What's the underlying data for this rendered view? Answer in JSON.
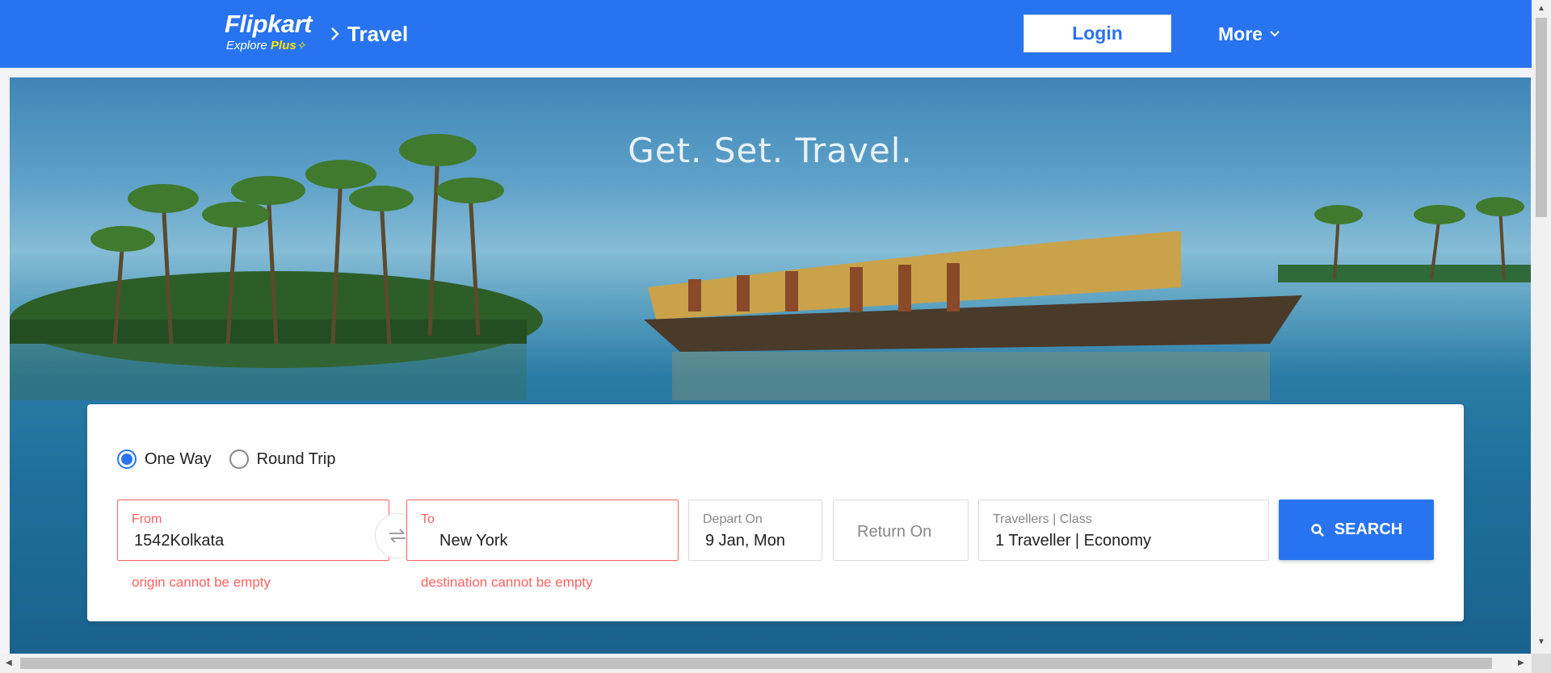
{
  "header": {
    "logo_main": "Flipkart",
    "logo_sub": "Explore",
    "logo_plus": "Plus",
    "breadcrumb": "Travel",
    "login_label": "Login",
    "more_label": "More",
    "bg_color": "#2874f0"
  },
  "hero": {
    "title": "Get. Set. Travel."
  },
  "search": {
    "trip_types": [
      {
        "label": "One Way",
        "selected": true
      },
      {
        "label": "Round Trip",
        "selected": false
      }
    ],
    "from": {
      "label": "From",
      "value": "1542Kolkata",
      "error": "origin cannot be empty"
    },
    "to": {
      "label": "To",
      "value": "New York",
      "error": "destination cannot be empty"
    },
    "depart": {
      "label": "Depart On",
      "value": "9 Jan, Mon"
    },
    "return": {
      "placeholder": "Return On"
    },
    "travellers": {
      "label": "Travellers | Class",
      "value": "1 Traveller | Economy"
    },
    "search_label": "SEARCH",
    "accent_color": "#2874f0",
    "error_color": "#ff6161"
  },
  "icons": {
    "swap": "swap-arrows-icon",
    "search": "search-icon",
    "more": "chevron-down-icon",
    "breadcrumb": "chevron-right-icon"
  }
}
